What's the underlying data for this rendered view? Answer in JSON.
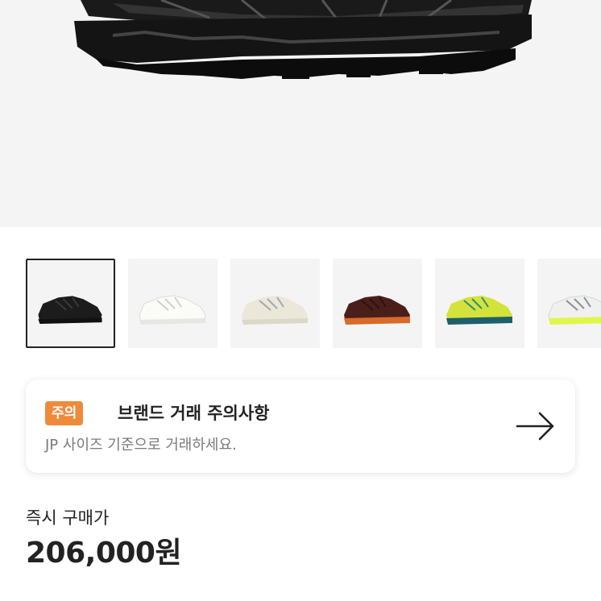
{
  "hero": {
    "image_icon": "black-sneaker-main-image"
  },
  "thumbnails": [
    {
      "icon": "black-sneaker-thumb",
      "colors": {
        "upper": "#1c1c1c",
        "sole": "#111111",
        "accent": "#3a3a3a"
      },
      "selected": true
    },
    {
      "icon": "white-sneaker-thumb",
      "colors": {
        "upper": "#f2f2ee",
        "sole": "#e6e6e2",
        "accent": "#d0d0cc"
      },
      "selected": false
    },
    {
      "icon": "cream-sneaker-thumb",
      "colors": {
        "upper": "#ebe7d9",
        "sole": "#dcd8c8",
        "accent": "#9fa9b3"
      },
      "selected": false
    },
    {
      "icon": "brown-orange-sneaker-thumb",
      "colors": {
        "upper": "#4a1f1a",
        "sole": "#d86a2a",
        "accent": "#2b1210"
      },
      "selected": false
    },
    {
      "icon": "lime-teal-sneaker-thumb",
      "colors": {
        "upper": "#d4e33a",
        "sole": "#1f5f6b",
        "accent": "#2f8a8a"
      },
      "selected": false
    },
    {
      "icon": "white-neon-sneaker-thumb",
      "colors": {
        "upper": "#f0f0ee",
        "sole": "#dff74a",
        "accent": "#8a8f99"
      },
      "selected": false
    }
  ],
  "notice": {
    "badge": "주의",
    "title": "브랜드 거래 주의사항",
    "subtitle": "JP 사이즈 기준으로 거래하세요.",
    "arrow_icon": "arrow-right-icon",
    "badge_color": "#ef8a3b"
  },
  "price": {
    "label": "즉시 구매가",
    "value": "206,000원"
  }
}
